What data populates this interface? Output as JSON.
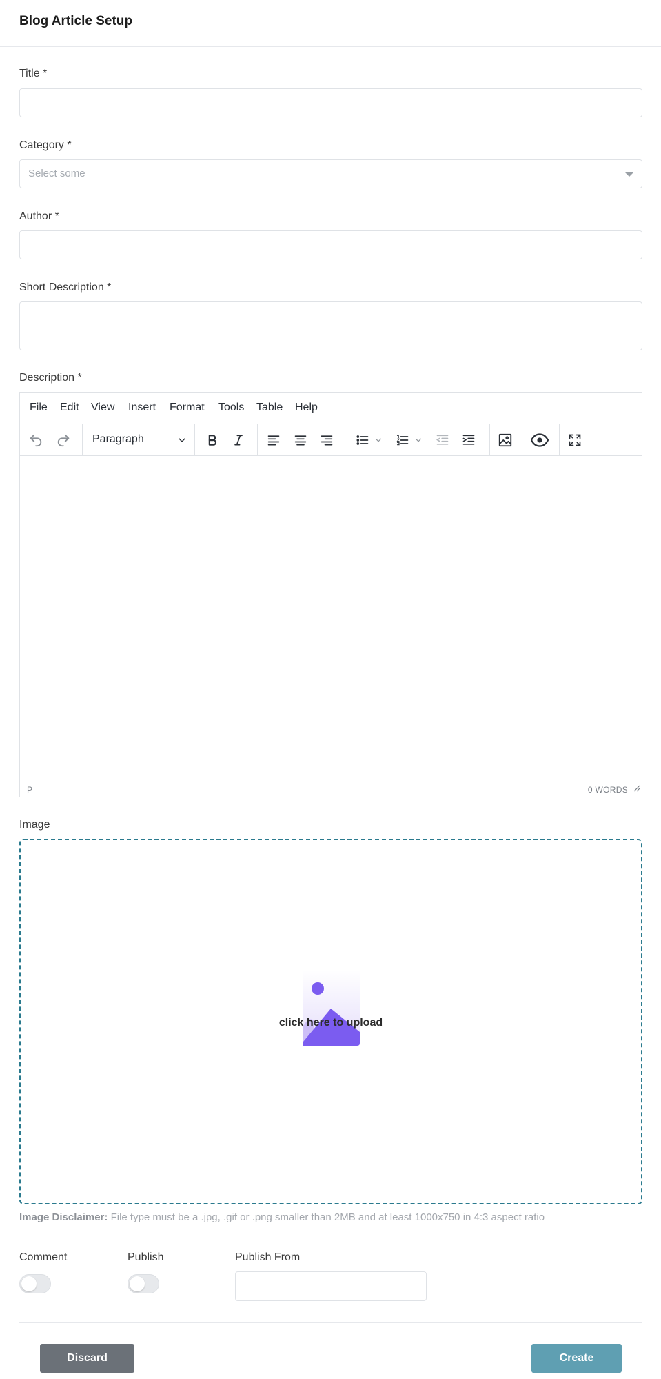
{
  "header": {
    "title": "Blog Article Setup"
  },
  "fields": {
    "title_label": "Title *",
    "title_value": "",
    "category_label": "Category *",
    "category_placeholder": "Select some",
    "author_label": "Author *",
    "author_value": "",
    "short_desc_label": "Short Description *",
    "short_desc_value": "",
    "description_label": "Description *"
  },
  "editor": {
    "menu": [
      "File",
      "Edit",
      "View",
      "Insert",
      "Format",
      "Tools",
      "Table",
      "Help"
    ],
    "block_format": "Paragraph",
    "status_path": "P",
    "word_count": "0 WORDS",
    "icons": [
      "undo-icon",
      "redo-icon",
      "bold-icon",
      "italic-icon",
      "align-left-icon",
      "align-center-icon",
      "align-right-icon",
      "bullet-list-icon",
      "numbered-list-icon",
      "outdent-icon",
      "indent-icon",
      "image-icon",
      "preview-icon",
      "fullscreen-icon"
    ]
  },
  "image": {
    "label": "Image",
    "upload_text": "click here to upload",
    "disclaimer_title": "Image Disclaimer:",
    "disclaimer_text": " File type must be a .jpg, .gif or .png smaller than 2MB and at least 1000x750 in 4:3 aspect ratio"
  },
  "options": {
    "comment_label": "Comment",
    "comment_on": false,
    "publish_label": "Publish",
    "publish_on": false,
    "publish_from_label": "Publish From",
    "publish_from_value": ""
  },
  "actions": {
    "discard": "Discard",
    "create": "Create"
  },
  "colors": {
    "dropzone_border": "#2a7a8e",
    "create_btn": "#5f9fb2",
    "discard_btn": "#6b7178",
    "upload_icon": "#7b5cf0"
  }
}
